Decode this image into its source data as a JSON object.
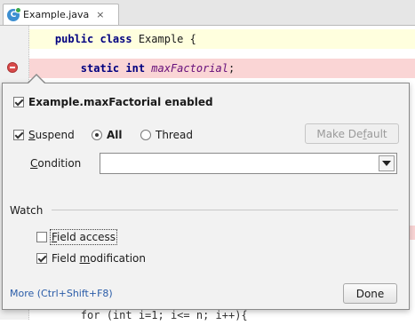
{
  "editor": {
    "tab": {
      "icon": "java-class-icon",
      "icon_glyph": "C",
      "title": "Example.java",
      "close_glyph": "×"
    },
    "code": {
      "line1": {
        "kw": "public class",
        "rest": " Example {"
      },
      "line2": {
        "kw": "static int",
        "field": "maxFactorial",
        "rest": ";"
      },
      "line_bottom": "for (int i=1; i<= n; i++){"
    },
    "breakpoint_icon": "breakpoint-icon"
  },
  "popup": {
    "title": "Example.maxFactorial enabled",
    "title_checked": true,
    "suspend": {
      "prefix": "",
      "underline": "S",
      "rest": "uspend",
      "checked": true
    },
    "suspend_options": [
      {
        "label": "All",
        "selected": true
      },
      {
        "label": "Thread",
        "selected": false
      }
    ],
    "make_default": {
      "prefix": "Make De",
      "underline": "f",
      "rest": "ault"
    },
    "condition": {
      "underline": "C",
      "rest": "ondition",
      "value": ""
    },
    "watch_label": "Watch",
    "field_access": {
      "underline": "F",
      "rest": "ield access",
      "checked": false
    },
    "field_modification": {
      "prefix": "Field ",
      "underline": "m",
      "rest": "odification",
      "checked": true
    },
    "more_link": "More (Ctrl+Shift+F8)",
    "done_button": "Done"
  }
}
